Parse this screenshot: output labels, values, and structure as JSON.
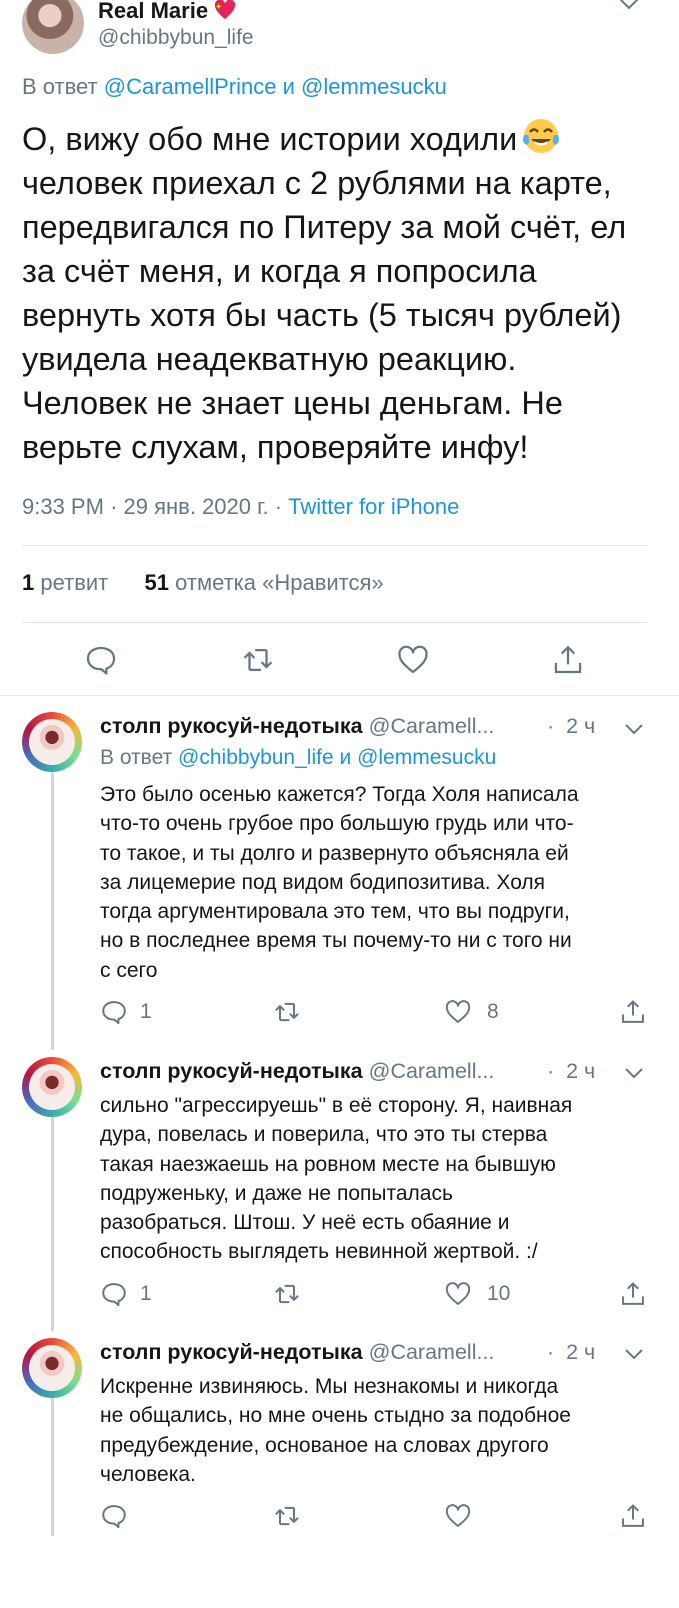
{
  "main_tweet": {
    "display_name": "Real Marie",
    "handle": "@chibbybun_life",
    "reply_prefix": "В ответ",
    "reply_user1": "@CaramellPrince",
    "reply_and": "и",
    "reply_user2": "@lemmesucku",
    "text_first_line": "О, вижу обо мне истории ходили",
    "text_rest": "человек приехал с 2 рублями на карте,\nпередвигался по Питеру за мой счёт, ел\nза счёт меня, и когда я попросила\nвернуть хотя бы часть (5 тысяч рублей)\nувидела неадекватную реакцию.\nЧеловек не знает цены деньгам. Не\nверьте слухам, проверяйте инфу!",
    "time": "9:33 PM",
    "date": "29 янв. 2020 г.",
    "dot": "·",
    "source": "Twitter for iPhone",
    "retweet_count": "1",
    "retweet_label": "ретвит",
    "like_count": "51",
    "like_label": "отметка «Нравится»"
  },
  "replies": [
    {
      "name": "столп рукосуй-недотыка",
      "handle": "@Caramell...",
      "dot": "·",
      "time": "2 ч",
      "reply_prefix": "В ответ",
      "reply_user1": "@chibbybun_life",
      "reply_and": "и",
      "reply_user2": "@lemmesucku",
      "text": "Это было осенью кажется? Тогда Холя написала\nчто-то очень грубое про большую грудь или что-\nто такое, и ты долго и развернуто объясняла ей\nза лицемерие под видом бодипозитива. Холя\nтогда аргументировала это тем, что вы подруги,\nно в последнее время ты почему-то ни с того ни\nс сего",
      "reply_count": "1",
      "retweet_count": "",
      "like_count": "8"
    },
    {
      "name": "столп рукосуй-недотыка",
      "handle": "@Caramell...",
      "dot": "·",
      "time": "2 ч",
      "text": "сильно \"агрессируешь\" в её сторону. Я, наивная\nдура, повелась и поверила, что это ты стерва\nтакая наезжаешь на ровном месте на бывшую\nподруженьку, и даже не попыталась\nразобраться. Штош. У неё есть обаяние и\nспособность выглядеть невинной жертвой. :/",
      "reply_count": "1",
      "retweet_count": "",
      "like_count": "10"
    },
    {
      "name": "столп рукосуй-недотыка",
      "handle": "@Caramell...",
      "dot": "·",
      "time": "2 ч",
      "text": "Искренне извиняюсь. Мы незнакомы и никогда\nне общались, но мне очень стыдно за подобное\nпредубеждение, основаное на словах другого\nчеловека.",
      "reply_count": "",
      "retweet_count": "",
      "like_count": ""
    }
  ],
  "icons": {
    "reply": "reply-icon",
    "retweet": "retweet-icon",
    "like": "like-icon",
    "share": "share-icon",
    "caret": "chevron-down-icon"
  },
  "colors": {
    "link": "#1b95e0",
    "secondary": "#657786",
    "text": "#14171a",
    "divider": "#e1e8ed",
    "thread": "#ccd6dd"
  }
}
